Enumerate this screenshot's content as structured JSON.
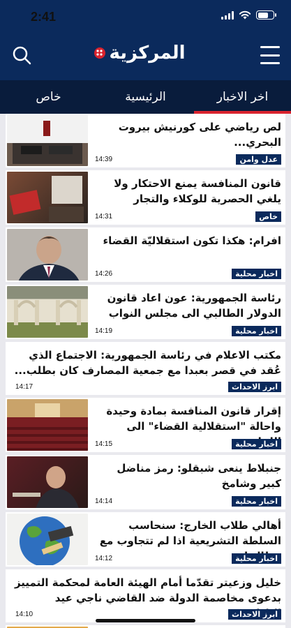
{
  "status": {
    "time": "2:41"
  },
  "header": {
    "logo_text": "المركزية"
  },
  "tabs": [
    {
      "label": "اخر الاخبار",
      "active": true
    },
    {
      "label": "الرئيسية",
      "active": false
    },
    {
      "label": "خاص",
      "active": false
    }
  ],
  "news": [
    {
      "title": "لص رياضي على كورنيش بيروت البحري...",
      "time": "14:39",
      "category": "عدل وامن"
    },
    {
      "title": "قانون المنافسة يمنع الاحتكار ولا يلغي الحصرية للوكلاء والتجار",
      "time": "14:31",
      "category": "خاص"
    },
    {
      "title": "افرام: هكذا تكون استقلاليّة القضاء",
      "time": "14:26",
      "category": "اخبار محلية"
    },
    {
      "title": "رئاسة الجمهورية: عون اعاد قانون الدولار الطالبي الى مجلس النواب بع...",
      "time": "14:19",
      "category": "اخبار محلية"
    },
    {
      "title": "مكتب الاعلام في رئاسة الجمهورية: الاجتماع الذي عُقد في قصر بعبدا مع جمعية المصارف كان بطلب...",
      "time": "14:17",
      "category": "ابرز الاحداث"
    },
    {
      "title": "إقرار قانون المنافسة بمادة وحيدة واحالة \"استقلالية القضاء\" الى اللجا...",
      "time": "14:15",
      "category": "اخبار محلية"
    },
    {
      "title": "جنبلاط ينعى شبقلو: رمز مناضل كبير وشامخ",
      "time": "14:14",
      "category": "اخبار محلية"
    },
    {
      "title": "أهالي طلاب الخارج: سنحاسب السلطة التشريعية اذا لم تتجاوب مع مطالبنا",
      "time": "14:12",
      "category": "اخبار محلية"
    },
    {
      "title": "خليل وزعيتر تقدّما أمام الهيئة العامة لمحكمة التمييز بدعوى مخاصمة الدولة ضد القاضي ناجي عيد الناظر...",
      "time": "14:10",
      "category": "ابرز الاحداث"
    }
  ],
  "colors": {
    "navy": "#0b2a5c",
    "accent": "#d9232e"
  },
  "icons": [
    "search-icon",
    "menu-icon"
  ]
}
